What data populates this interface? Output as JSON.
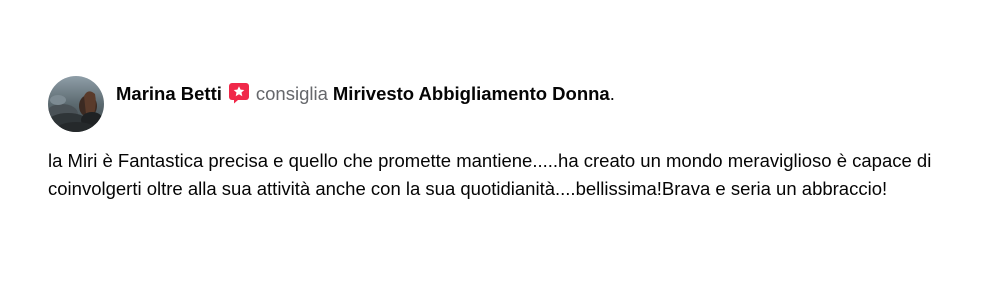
{
  "post": {
    "author": "Marina Betti",
    "recommend_icon": "recommend-star-icon",
    "verb": "consiglia",
    "page_name": "Mirivesto Abbigliamento Donna",
    "period": ".",
    "text": "la Miri è Fantastica precisa e quello che promette mantiene.....ha creato un mondo meraviglioso è capace di coinvolgerti oltre alla sua attività anche con la sua quotidianità....bellissima!Brava e seria un abbraccio!"
  },
  "colors": {
    "recommend_badge": "#f02849",
    "text_primary": "#050505",
    "text_secondary": "#65676b"
  }
}
